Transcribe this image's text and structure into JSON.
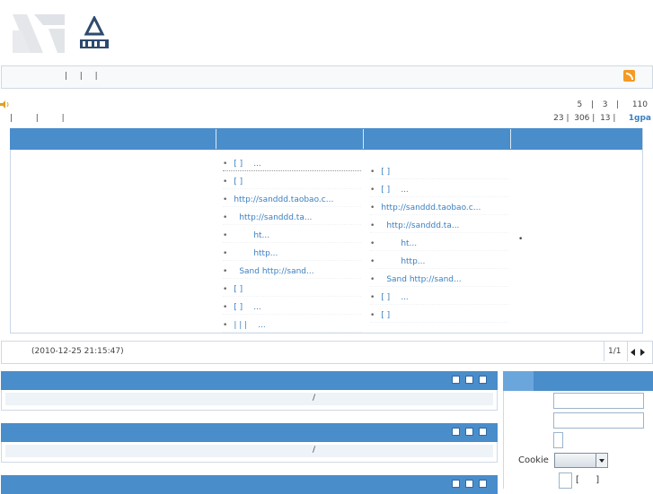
{
  "header": {
    "logo_alt": "logo"
  },
  "navbar": {
    "items": [
      "|",
      "|",
      "|"
    ],
    "rss_icon": "rss-icon"
  },
  "notice": {
    "icon": "speaker-icon"
  },
  "stats_right": {
    "line1": [
      "5",
      "|",
      "3",
      "|",
      "110"
    ],
    "line2": [
      "23",
      "|",
      "306",
      "|",
      "13",
      "|",
      "1gpa"
    ]
  },
  "stats_left": {
    "seps": [
      "|",
      "|",
      "|"
    ]
  },
  "columns": {
    "col2": [
      {
        "prefix": "[ ]",
        "text": "...",
        "link": false
      },
      {
        "prefix": "[ ]",
        "text": "",
        "link": false
      },
      {
        "prefix": "",
        "text": "http://sanddd.taobao.c...",
        "link": true
      },
      {
        "prefix": "",
        "text": "http://sanddd.ta...",
        "link": true
      },
      {
        "prefix": "",
        "text": "ht...",
        "link": true
      },
      {
        "prefix": "",
        "text": "http...",
        "link": true
      },
      {
        "prefix": "",
        "text": "Sand http://sand...",
        "link": true
      },
      {
        "prefix": "[ ]",
        "text": "",
        "link": false
      },
      {
        "prefix": "[ ]",
        "text": "...",
        "link": false
      },
      {
        "prefix": "|  |  |",
        "text": "...",
        "link": false
      }
    ],
    "col3": [
      {
        "prefix": "[ ]",
        "text": "",
        "link": false
      },
      {
        "prefix": "[ ]",
        "text": "...",
        "link": false
      },
      {
        "prefix": "",
        "text": "http://sanddd.taobao.c...",
        "link": true
      },
      {
        "prefix": "",
        "text": "http://sanddd.ta...",
        "link": true
      },
      {
        "prefix": "",
        "text": "ht...",
        "link": true
      },
      {
        "prefix": "",
        "text": "http...",
        "link": true
      },
      {
        "prefix": "",
        "text": "Sand http://sand...",
        "link": true
      },
      {
        "prefix": "[ ]",
        "text": "...",
        "link": false
      },
      {
        "prefix": "[ ]",
        "text": "",
        "link": false
      }
    ],
    "col4_bullet": "•"
  },
  "footer": {
    "timestamp": "(2010-12-25 21:15:47)",
    "page": "1/1",
    "prev_icon": "arrow-left-icon",
    "next_icon": "arrow-right-icon"
  },
  "panels": [
    {
      "slash": "/"
    },
    {
      "slash": "/"
    },
    {
      "slash": ""
    }
  ],
  "login": {
    "cookie_label": "Cookie",
    "remember": "[",
    "remember_close": "]"
  },
  "colors": {
    "accent": "#4a8dcb",
    "link": "#3a7fc1",
    "border": "#cfd9e4"
  }
}
